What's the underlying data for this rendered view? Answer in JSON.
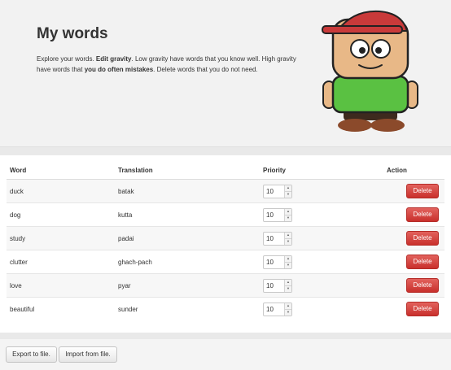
{
  "hero": {
    "title": "My words",
    "desc_1": "Explore your words. ",
    "desc_2": "Edit gravity",
    "desc_3": ". Low gravity have words that you know well. High gravity have words that ",
    "desc_4": "you do often mistakes",
    "desc_5": ". Delete words that you do not need."
  },
  "table": {
    "headers": {
      "word": "Word",
      "translation": "Translation",
      "priority": "Priority",
      "action": "Action"
    },
    "rows": [
      {
        "word": "duck",
        "translation": "batak",
        "priority": "10"
      },
      {
        "word": "dog",
        "translation": "kutta",
        "priority": "10"
      },
      {
        "word": "study",
        "translation": "padai",
        "priority": "10"
      },
      {
        "word": "clutter",
        "translation": "ghach-pach",
        "priority": "10"
      },
      {
        "word": "love",
        "translation": "pyar",
        "priority": "10"
      },
      {
        "word": "beautiful",
        "translation": "sunder",
        "priority": "10"
      }
    ],
    "delete_label": "Delete"
  },
  "footer": {
    "export_label": "Export to file.",
    "import_label": "Import from file."
  },
  "colors": {
    "danger": "#d9534f",
    "hero_bg": "#f2f2f2"
  },
  "icons": {
    "mascot": "cartoon-boy-mascot"
  }
}
